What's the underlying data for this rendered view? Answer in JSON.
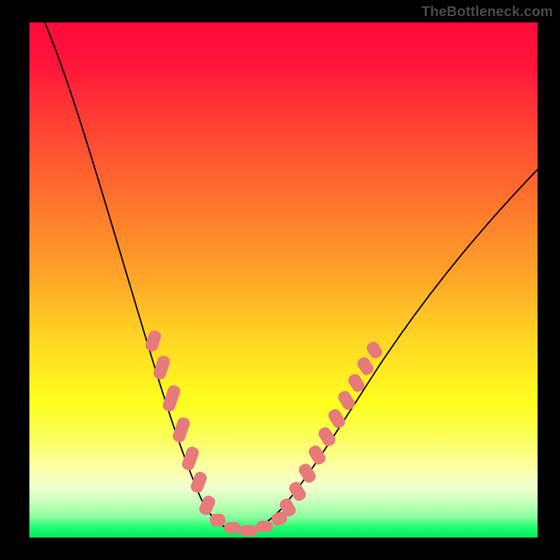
{
  "watermark": "TheBottleneck.com",
  "colors": {
    "curve": "#000000",
    "dot": "#e77a7a",
    "frame": "#000000"
  },
  "chart_data": {
    "type": "line",
    "title": "",
    "xlabel": "",
    "ylabel": "",
    "xlim": [
      0,
      100
    ],
    "ylim": [
      0,
      100
    ],
    "grid": false,
    "series": [
      {
        "name": "bottleneck-curve",
        "x": [
          3,
          6,
          9,
          12,
          15,
          18,
          21,
          23,
          25,
          27,
          29,
          31,
          33,
          35,
          36.5,
          38,
          40,
          42,
          44,
          46,
          48,
          50,
          53,
          56,
          60,
          64,
          68,
          74,
          80,
          88,
          96,
          100
        ],
        "y": [
          100,
          93,
          86,
          79,
          72,
          65,
          58,
          52,
          46,
          40,
          34,
          28,
          22,
          16,
          12,
          9,
          5.5,
          3.5,
          2.5,
          2,
          3,
          4.5,
          8,
          12,
          17.5,
          23,
          28.5,
          36,
          43,
          52,
          61,
          64.5
        ]
      }
    ],
    "annotations": {
      "note": "pink marker segments overlay the curve near the trough and its approaches",
      "left_segment_x_range": [
        24,
        33
      ],
      "right_segment_x_range": [
        44,
        54
      ],
      "trough_segment_x_range": [
        35,
        46
      ]
    }
  }
}
